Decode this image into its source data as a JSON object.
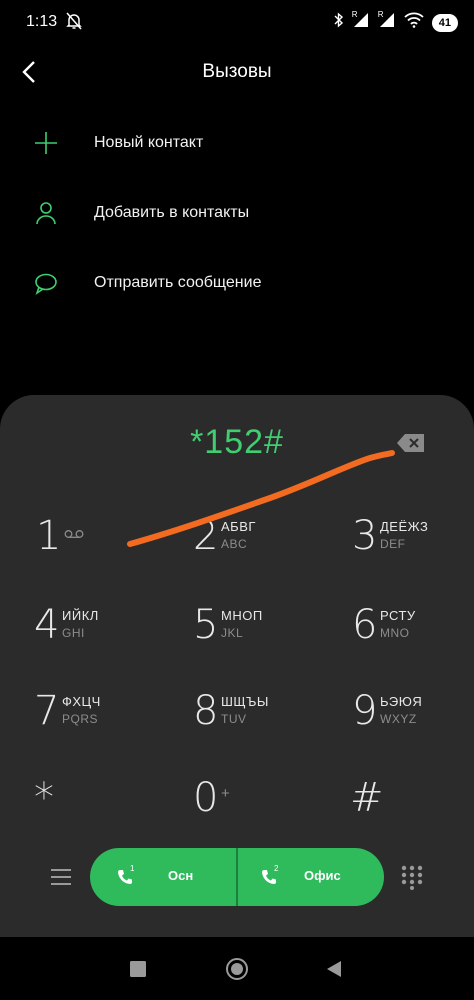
{
  "status_bar": {
    "time": "1:13",
    "battery": "41",
    "sim1": "R",
    "sim2": "R"
  },
  "header": {
    "title": "Вызовы"
  },
  "menu": [
    {
      "label": "Новый контакт",
      "icon": "plus-icon"
    },
    {
      "label": "Добавить в контакты",
      "icon": "person-icon"
    },
    {
      "label": "Отправить сообщение",
      "icon": "message-icon"
    }
  ],
  "dialer": {
    "number": "*152#",
    "keys": [
      {
        "digit": "1",
        "l1": "",
        "l2": ""
      },
      {
        "digit": "2",
        "l1": "АБВГ",
        "l2": "ABC"
      },
      {
        "digit": "3",
        "l1": "ДЕЁЖЗ",
        "l2": "DEF"
      },
      {
        "digit": "4",
        "l1": "ИЙКЛ",
        "l2": "GHI"
      },
      {
        "digit": "5",
        "l1": "МНОП",
        "l2": "JKL"
      },
      {
        "digit": "6",
        "l1": "РСТУ",
        "l2": "MNO"
      },
      {
        "digit": "7",
        "l1": "ФХЦЧ",
        "l2": "PQRS"
      },
      {
        "digit": "8",
        "l1": "ШЩЪЫ",
        "l2": "TUV"
      },
      {
        "digit": "9",
        "l1": "ЬЭЮЯ",
        "l2": "WXYZ"
      },
      {
        "digit": "*",
        "l1": "",
        "l2": ""
      },
      {
        "digit": "0",
        "l1": "+",
        "l2": ""
      },
      {
        "digit": "#",
        "l1": "",
        "l2": ""
      }
    ]
  },
  "call_buttons": [
    {
      "label": "Осн",
      "sim": "1"
    },
    {
      "label": "Офис",
      "sim": "2"
    }
  ],
  "colors": {
    "accent": "#3fcf70",
    "call_green": "#2fba5c",
    "panel": "#2b2b2b",
    "annotation": "#f26b21"
  }
}
